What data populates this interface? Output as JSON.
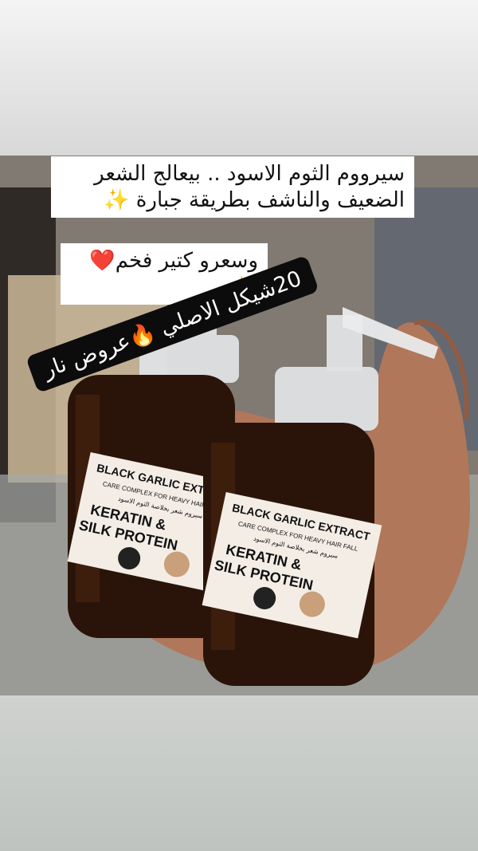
{
  "story": {
    "caption_line1": "سيرووم الثوم الاسود .. بيعالج الشعر",
    "caption_line2": "الضعيف والناشف بطريقة جبارة ✨",
    "caption_line3": "وسعرو كتير فخم❤️✨",
    "promo_text": "20شيكل الاصلي 🔥عروض نار"
  },
  "product": {
    "brand": "BLACK GARLIC EXTRACT",
    "subtitle": "CARE COMPLEX FOR HEAVY HAIR FALL",
    "arabic_line": "سيروم شعر بخلاصة الثوم الاسود",
    "name_line1": "KERATIN &",
    "name_line2": "SILK PROTEIN"
  }
}
